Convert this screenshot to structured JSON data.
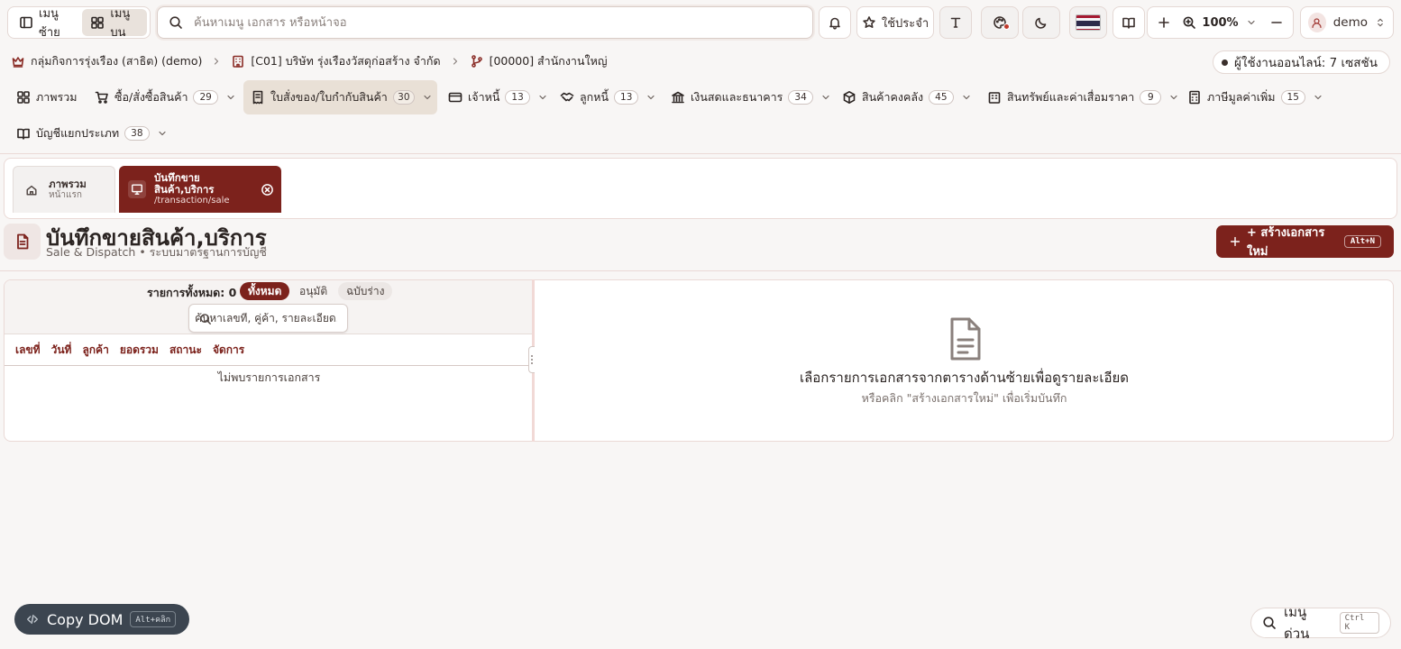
{
  "topbar": {
    "left_menu_label": "เมนูซ้าย",
    "top_menu_label": "เมนูบน",
    "search_placeholder": "ค้นหาเมนู เอกสาร หรือหน้าจอ",
    "favorites_label": "ใช้ประจำ",
    "zoom_value": "100%",
    "user_name": "demo"
  },
  "breadcrumb": {
    "group": "กลุ่มกิจการรุ่งเรือง (สาธิต) (demo)",
    "company": "[C01] บริษัท รุ่งเรืองวัสดุก่อสร้าง จำกัด",
    "branch": "[00000] สำนักงานใหญ่"
  },
  "online_users": "ผู้ใช้งานออนไลน์: 7 เซสชัน",
  "nav": {
    "items": [
      {
        "label": "ภาพรวม",
        "count": null
      },
      {
        "label": "ซื้อ/สั่งซื้อสินค้า",
        "count": "29"
      },
      {
        "label": "ใบสั่งของ/ใบกำกับสินค้า",
        "count": "30"
      },
      {
        "label": "เจ้าหนี้",
        "count": "13"
      },
      {
        "label": "ลูกหนี้",
        "count": "13"
      },
      {
        "label": "เงินสดและธนาคาร",
        "count": "34"
      },
      {
        "label": "สินค้าคงคลัง",
        "count": "45"
      },
      {
        "label": "สินทรัพย์และค่าเสื่อมราคา",
        "count": "9"
      },
      {
        "label": "ภาษีมูลค่าเพิ่ม",
        "count": "15"
      },
      {
        "label": "บัญชีแยกประเภท",
        "count": "38"
      }
    ]
  },
  "tabs": [
    {
      "title": "ภาพรวม",
      "subtitle": "หน้าแรก"
    },
    {
      "title_line1": "บันทึกขาย",
      "title_line2": "สินค้า,บริการ",
      "subtitle": "/transaction/sale"
    }
  ],
  "page": {
    "title": "บันทึกขายสินค้า,บริการ",
    "subtitle": "Sale & Dispatch • ระบบมาตรฐานการบัญชี",
    "new_doc_label": "+ สร้างเอกสารใหม่",
    "new_doc_shortcut": "Alt+N"
  },
  "list": {
    "total_label": "รายการทั้งหมด:",
    "total_value": "0",
    "filters": [
      "ทั้งหมด",
      "อนุมัติ",
      "ฉบับร่าง"
    ],
    "search_placeholder": "ค้นหาเลขที่, คู่ค้า, รายละเอียด...",
    "columns": [
      "เลขที่",
      "วันที่",
      "ลูกค้า",
      "ยอดรวม",
      "สถานะ",
      "จัดการ"
    ],
    "empty_text": "ไม่พบรายการเอกสาร"
  },
  "detail": {
    "title": "เลือกรายการเอกสารจากตารางด้านซ้ายเพื่อดูรายละเอียด",
    "subtitle": "หรือคลิก \"สร้างเอกสารใหม่\" เพื่อเริ่มบันทึก"
  },
  "floating": {
    "copy_dom_label": "Copy DOM",
    "copy_dom_shortcut": "Alt+คลิก",
    "quick_menu_label": "เมนูด่วน",
    "quick_menu_shortcut": "Ctrl K"
  },
  "colors": {
    "accent": "#7c221c",
    "background": "#f8f6f5",
    "active_nav_bg": "#e9e0d6"
  },
  "icons": [
    "sidebar-icon",
    "grid-icon",
    "search-icon",
    "bell-icon",
    "star-icon",
    "text-icon",
    "palette-icon",
    "moon-icon",
    "flag-icon",
    "book-icon",
    "plus-icon",
    "zoom-icon",
    "minus-icon",
    "user-icon",
    "crown-icon",
    "building-icon",
    "branch-icon",
    "dashboard-icon",
    "cart-icon",
    "receipt-icon",
    "card-icon",
    "handshake-icon",
    "bank-icon",
    "box-icon",
    "asset-icon",
    "calc-icon",
    "ledger-icon",
    "home-icon",
    "monitor-icon",
    "close-circle-icon",
    "document-icon",
    "grip-icon",
    "code-icon"
  ]
}
